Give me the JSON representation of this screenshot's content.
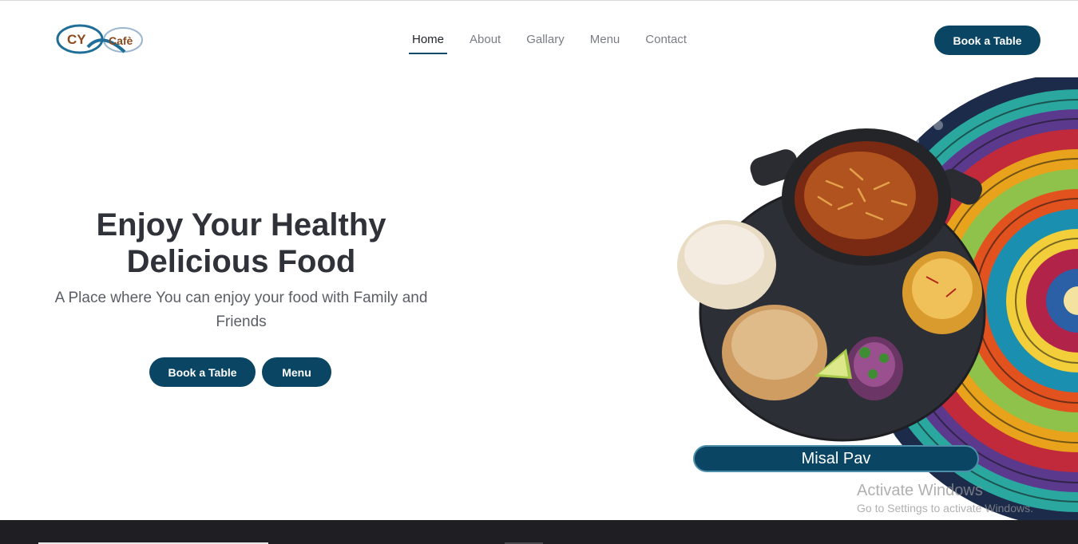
{
  "brand": {
    "logo_text_1": "CY",
    "logo_text_2": "Cafè",
    "logo_alt": "CY Cafè logo"
  },
  "nav": {
    "items": [
      {
        "label": "Home",
        "active": true
      },
      {
        "label": "About",
        "active": false
      },
      {
        "label": "Gallary",
        "active": false
      },
      {
        "label": "Menu",
        "active": false
      },
      {
        "label": "Contact",
        "active": false
      }
    ],
    "book_label": "Book a Table"
  },
  "hero": {
    "title_line1": "Enjoy Your Healthy",
    "title_line2": "Delicious Food",
    "subtitle": "A Place where You can enjoy your food with Family and Friends",
    "primary_button": "Book a Table",
    "secondary_button": "Menu"
  },
  "dish": {
    "label": "Misal Pav"
  },
  "watermark": {
    "title": "Activate Windows",
    "subtitle": "Go to Settings to activate Windows."
  },
  "colors": {
    "primary": "#0a4563",
    "text_dark": "#2f3238",
    "footer": "#1f1e23"
  }
}
